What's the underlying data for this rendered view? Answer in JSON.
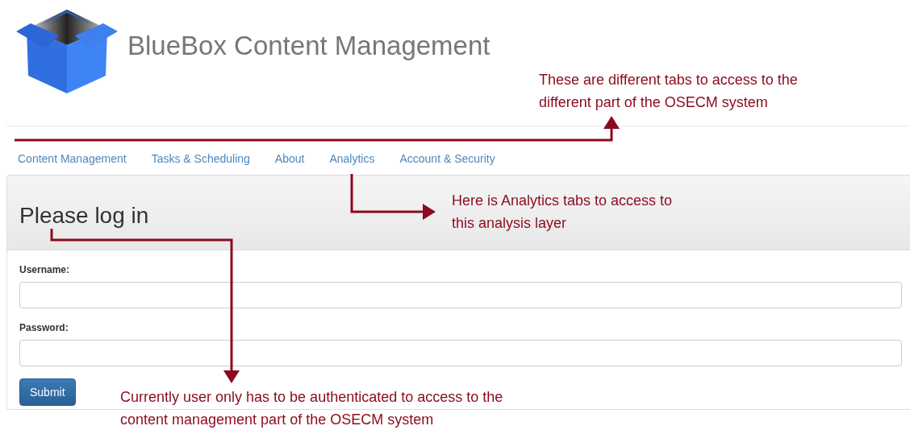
{
  "header": {
    "title": "BlueBox Content Management"
  },
  "nav": {
    "tabs": [
      {
        "label": "Content Management"
      },
      {
        "label": "Tasks & Scheduling"
      },
      {
        "label": "About"
      },
      {
        "label": "Analytics"
      },
      {
        "label": "Account & Security"
      }
    ]
  },
  "panel": {
    "heading": "Please log in",
    "fields": [
      {
        "label": "Username:"
      },
      {
        "label": "Password:"
      }
    ],
    "submit": "Submit"
  },
  "annotations": [
    {
      "lines": [
        "These are different tabs to access to the",
        "different part of the OSECM system"
      ]
    },
    {
      "lines": [
        "Here is Analytics tabs to access to",
        "this analysis layer"
      ]
    },
    {
      "lines": [
        "Currently user only has to be authenticated to access to the",
        "content management part of the OSECM system"
      ]
    }
  ]
}
